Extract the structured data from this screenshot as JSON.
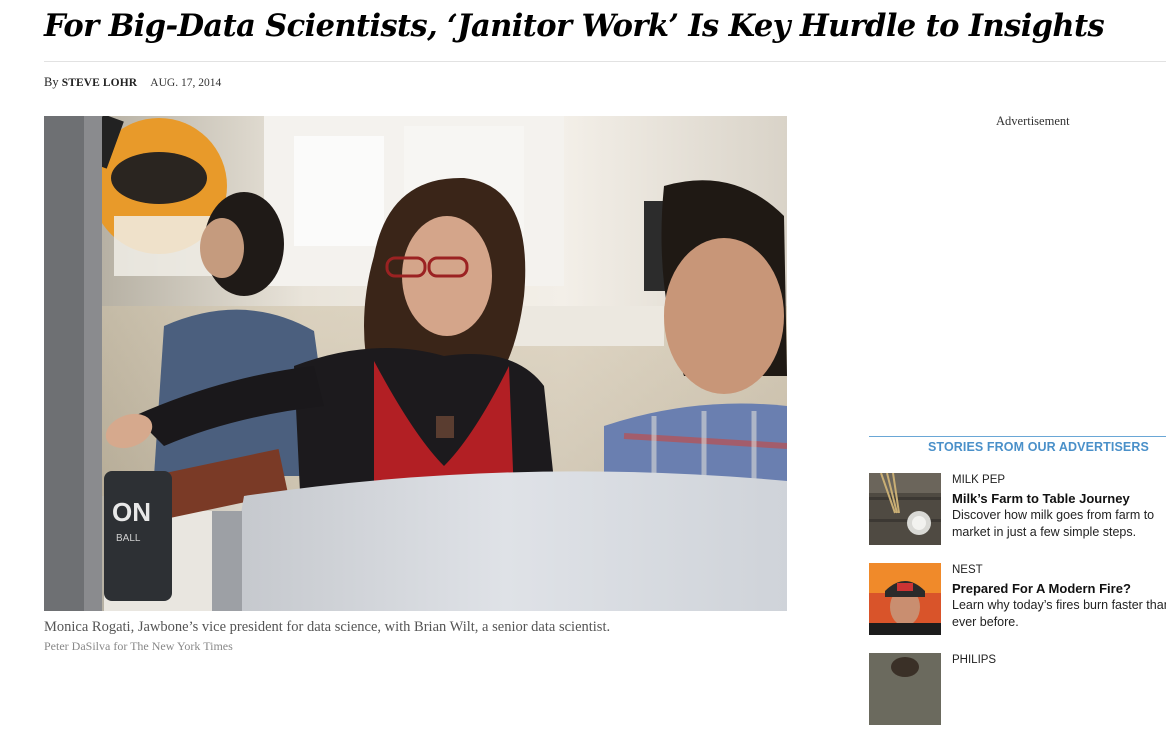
{
  "article": {
    "headline": "For Big-Data Scientists, ‘Janitor Work’ Is Key Hurdle to Insights",
    "byline_prefix": "By",
    "author": "STEVE LOHR",
    "date": "AUG. 17, 2014"
  },
  "photo": {
    "caption": "Monica Rogati, Jawbone’s vice president for data science, with Brian Wilt, a senior data scientist.",
    "credit": "Peter DaSilva for The New York Times",
    "can_text": "ON",
    "can_subtext": "BALL"
  },
  "sidebar": {
    "ad_label": "Advertisement",
    "advertisers_title": "STORIES FROM OUR ADVERTISERS",
    "stories": [
      {
        "sponsor": "MILK PEP",
        "headline": "Milk’s Farm to Table Journey",
        "description_lines": [
          "Discover how milk goes from farm to",
          "market in just a few simple steps."
        ]
      },
      {
        "sponsor": "NEST",
        "headline": "Prepared For A Modern Fire?",
        "description_lines": [
          "Learn why today’s fires burn faster than",
          "ever before."
        ]
      },
      {
        "sponsor": "PHILIPS",
        "headline": "",
        "description_lines": []
      }
    ]
  },
  "colors": {
    "advertiser_accent": "#4a90c9",
    "caption_text": "#555555",
    "credit_text": "#888888"
  }
}
